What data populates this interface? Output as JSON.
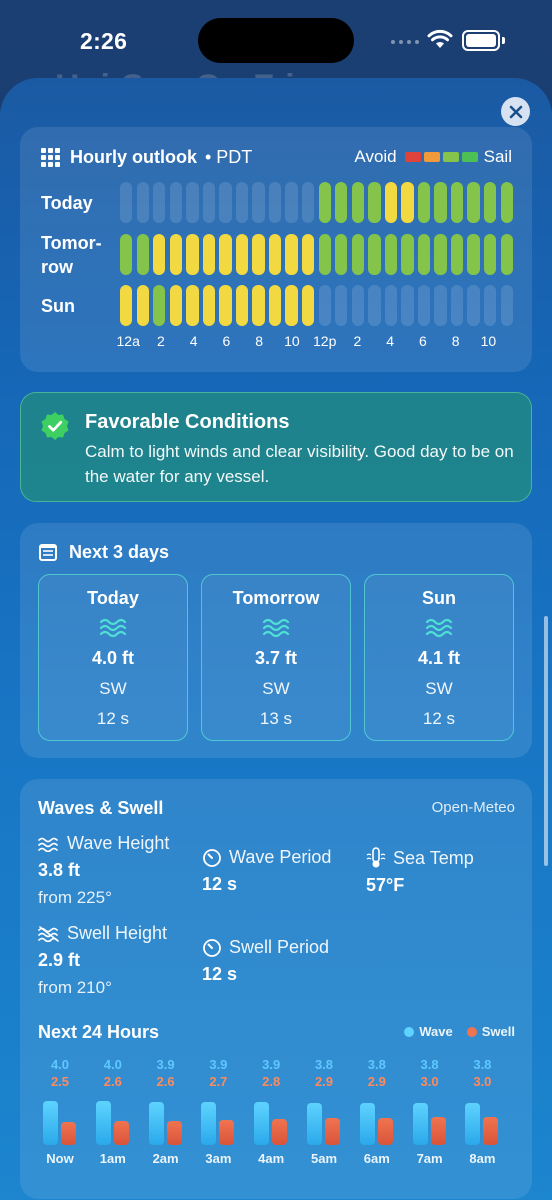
{
  "status_bar": {
    "time": "2:26"
  },
  "background_title": "Hai    Sea    Co  F   i",
  "colors": {
    "avoid": "#e0433c",
    "poor": "#f29a3a",
    "ok": "#f2d841",
    "good": "#84c44a",
    "sail": "#4cbf55",
    "empty": "rgba(255,255,255,0.13)"
  },
  "hourly": {
    "title": "Hourly outlook",
    "timezone": "• PDT",
    "legend_avoid": "Avoid",
    "legend_sail": "Sail",
    "legend_colors": [
      "#e0433c",
      "#f29a3a",
      "#84c44a",
      "#4cbf55"
    ],
    "rows": [
      {
        "label": "Today",
        "slots": [
          "e",
          "e",
          "e",
          "e",
          "e",
          "e",
          "e",
          "e",
          "e",
          "e",
          "e",
          "e",
          "g",
          "g",
          "g",
          "g",
          "y",
          "y",
          "g",
          "g",
          "g",
          "g",
          "g",
          "g"
        ]
      },
      {
        "label": "Tomor-\nrow",
        "slots": [
          "g",
          "g",
          "y",
          "y",
          "y",
          "y",
          "y",
          "y",
          "y",
          "y",
          "y",
          "y",
          "g",
          "g",
          "g",
          "g",
          "g",
          "g",
          "g",
          "g",
          "g",
          "g",
          "g",
          "g"
        ]
      },
      {
        "label": "Sun",
        "slots": [
          "y",
          "y",
          "g",
          "y",
          "y",
          "y",
          "y",
          "y",
          "y",
          "y",
          "y",
          "y",
          "e",
          "e",
          "e",
          "e",
          "e",
          "e",
          "e",
          "e",
          "e",
          "e",
          "e",
          "e"
        ]
      }
    ],
    "hour_labels": [
      "12a",
      "2",
      "4",
      "6",
      "8",
      "10",
      "12p",
      "2",
      "4",
      "6",
      "8",
      "10"
    ]
  },
  "favorable": {
    "title": "Favorable Conditions",
    "description": "Calm to light winds and clear visibility. Good day to be on the water for any vessel."
  },
  "next_days": {
    "title": "Next 3 days",
    "days": [
      {
        "name": "Today",
        "height": "4.0 ft",
        "direction": "SW",
        "period": "12 s"
      },
      {
        "name": "Tomorrow",
        "height": "3.7 ft",
        "direction": "SW",
        "period": "13 s"
      },
      {
        "name": "Sun",
        "height": "4.1 ft",
        "direction": "SW",
        "period": "12 s"
      }
    ]
  },
  "waves": {
    "title": "Waves & Swell",
    "source": "Open-Meteo",
    "wave_height": {
      "label": "Wave Height",
      "value": "3.8 ft",
      "from": "from 225°"
    },
    "wave_period": {
      "label": "Wave Period",
      "value": "12 s"
    },
    "sea_temp": {
      "label": "Sea Temp",
      "value": "57°F"
    },
    "swell_height": {
      "label": "Swell Height",
      "value": "2.9 ft",
      "from": "from 210°"
    },
    "swell_period": {
      "label": "Swell Period",
      "value": "12 s"
    },
    "next24": {
      "title": "Next 24 Hours",
      "legend_wave": "Wave",
      "legend_swell": "Swell",
      "hours": [
        {
          "label": "Now",
          "wave": "4.0",
          "swell": "2.5"
        },
        {
          "label": "1am",
          "wave": "4.0",
          "swell": "2.6"
        },
        {
          "label": "2am",
          "wave": "3.9",
          "swell": "2.6"
        },
        {
          "label": "3am",
          "wave": "3.9",
          "swell": "2.7"
        },
        {
          "label": "4am",
          "wave": "3.9",
          "swell": "2.8"
        },
        {
          "label": "5am",
          "wave": "3.8",
          "swell": "2.9"
        },
        {
          "label": "6am",
          "wave": "3.8",
          "swell": "2.9"
        },
        {
          "label": "7am",
          "wave": "3.8",
          "swell": "3.0"
        },
        {
          "label": "8am",
          "wave": "3.8",
          "swell": "3.0"
        }
      ]
    }
  }
}
